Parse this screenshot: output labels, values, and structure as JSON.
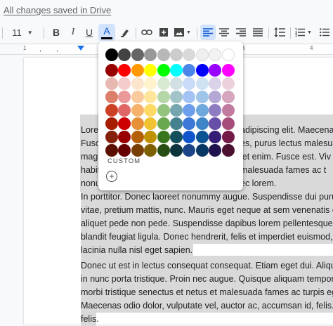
{
  "status": {
    "save_text": "All changes saved in Drive"
  },
  "toolbar": {
    "font_size": "11",
    "bold_label": "B",
    "italic_label": "I",
    "underline_label": "U",
    "text_color_label": "A",
    "text_color_icon": "text-color-icon",
    "highlight_icon": "highlighter-icon",
    "link_icon": "link-icon",
    "comment_icon": "add-comment-icon",
    "image_icon": "insert-image-icon",
    "line_spacing_icon": "line-spacing-icon",
    "numbered_list_icon": "numbered-list-icon",
    "more_icon": "more-icon"
  },
  "ruler": {
    "numbers": [
      "1",
      "1",
      "2",
      "3",
      "4"
    ]
  },
  "color_palette": {
    "custom_label": "CUSTOM",
    "add_icon": "add-custom-color-icon",
    "rows": [
      [
        "#000000",
        "#434343",
        "#666666",
        "#999999",
        "#b7b7b7",
        "#cccccc",
        "#d9d9d9",
        "#efefef",
        "#f3f3f3",
        "#ffffff"
      ],
      [
        "#980000",
        "#ff0000",
        "#ff9900",
        "#ffff00",
        "#00ff00",
        "#00ffff",
        "#4a86e8",
        "#0000ff",
        "#9900ff",
        "#ff00ff"
      ],
      [
        "#e6b8af",
        "#f4cccc",
        "#fce5cd",
        "#fff2cc",
        "#d9ead3",
        "#d0e0e3",
        "#c9daf8",
        "#cfe2f3",
        "#d9d2e9",
        "#ead1dc"
      ],
      [
        "#dd7e6b",
        "#ea9999",
        "#f9cb9c",
        "#ffe599",
        "#b6d7a8",
        "#a2c4c9",
        "#a4c2f4",
        "#9fc5e8",
        "#b4a7d6",
        "#d5a6bd"
      ],
      [
        "#cc4125",
        "#e06666",
        "#f6b26b",
        "#ffd966",
        "#93c47d",
        "#76a5af",
        "#6d9eeb",
        "#6fa8dc",
        "#8e7cc3",
        "#c27ba0"
      ],
      [
        "#a61c00",
        "#cc0000",
        "#e69138",
        "#f1c232",
        "#6aa84f",
        "#45818e",
        "#3c78d8",
        "#3d85c6",
        "#674ea7",
        "#a64d79"
      ],
      [
        "#85200c",
        "#990000",
        "#b45f06",
        "#bf9000",
        "#38761d",
        "#134f5c",
        "#1155cc",
        "#0b5394",
        "#351c75",
        "#741b47"
      ],
      [
        "#5b0f00",
        "#660000",
        "#783f04",
        "#7f6000",
        "#274e13",
        "#0c343d",
        "#1c4587",
        "#073763",
        "#20124d",
        "#4c1130"
      ]
    ]
  },
  "document": {
    "p1": [
      "Lore",
      "Fusc",
      "magr",
      "habit",
      "nonu"
    ],
    "p1_right": [
      "adipiscing elit. Maecena",
      "es, purus lectus malesua",
      "iet enim. Fusce est. Viv",
      "malesuada fames ac t",
      "ec lorem."
    ],
    "p2": [
      "In porttitor. Donec laoreet nonummy augue. Suspendisse dui purus",
      "vitae, pretium mattis, nunc. Mauris eget neque at sem venenatis el",
      "aliquet pede non pede. Suspendisse dapibus lorem pellentesque m",
      "blandit feugiat ligula. Donec hendrerit, felis et imperdiet euismod, p",
      "lacinia nulla nisl eget sapien."
    ],
    "p3": [
      "Donec ut est in lectus consequat consequat. Etiam eget dui. Aliqua",
      "in nunc porta tristique. Proin nec augue. Quisque aliquam tempor m",
      "morbi tristique senectus et netus et malesuada fames ac turpis eges",
      "Maecenas odio dolor, vulputate vel, auctor ac, accumsan id, felis.",
      "felis."
    ]
  }
}
